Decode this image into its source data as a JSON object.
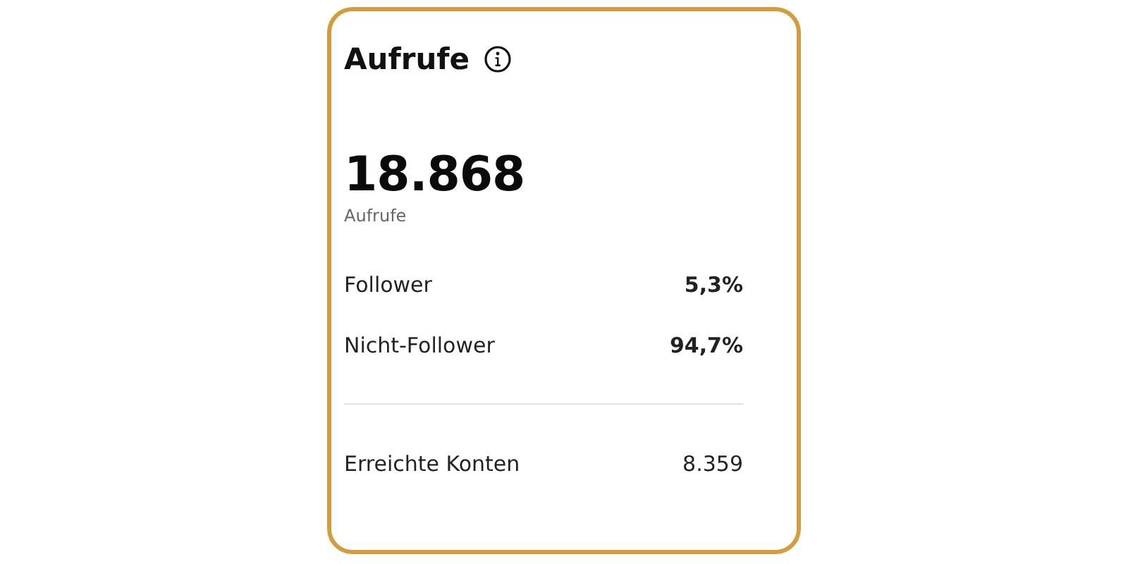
{
  "card": {
    "title": "Aufrufe",
    "total": {
      "value": "18.868",
      "label": "Aufrufe"
    },
    "breakdown": [
      {
        "label": "Follower",
        "value": "5,3%"
      },
      {
        "label": "Nicht-Follower",
        "value": "94,7%"
      }
    ],
    "summary": [
      {
        "label": "Erreichte Konten",
        "value": "8.359"
      }
    ]
  }
}
